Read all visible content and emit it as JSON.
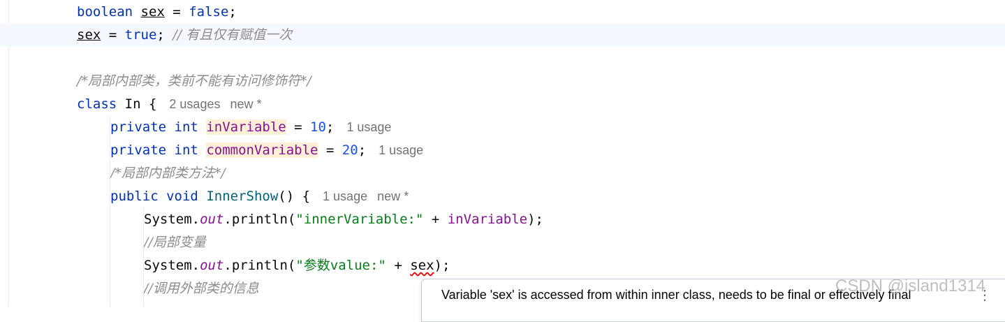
{
  "editor": {
    "lines": [
      {
        "tokens": [
          {
            "t": "boolean",
            "c": "kw"
          },
          {
            "t": " "
          },
          {
            "t": "sex",
            "c": "uline"
          },
          {
            "t": " = "
          },
          {
            "t": "false",
            "c": "bool"
          },
          {
            "t": ";"
          }
        ]
      },
      {
        "tokens": [
          {
            "t": "sex",
            "c": "uline"
          },
          {
            "t": " = "
          },
          {
            "t": "true",
            "c": "bool"
          },
          {
            "t": "; "
          },
          {
            "t": "// 有且仅有赋值一次",
            "c": "comment"
          }
        ]
      },
      {
        "tokens": []
      },
      {
        "tokens": [
          {
            "t": "/*局部内部类，类前不能有访问修饰符*/",
            "c": "comment"
          }
        ]
      },
      {
        "tokens": [
          {
            "t": "class",
            "c": "kw"
          },
          {
            "t": " In {"
          }
        ],
        "hints": [
          "2 usages",
          "new *"
        ]
      },
      {
        "tokens": [
          {
            "t": "private",
            "c": "kw"
          },
          {
            "t": " "
          },
          {
            "t": "int",
            "c": "kw"
          },
          {
            "t": " "
          },
          {
            "t": "inVariable",
            "c": "field hl"
          },
          {
            "t": " = "
          },
          {
            "t": "10",
            "c": "num"
          },
          {
            "t": ";"
          }
        ],
        "hints": [
          "1 usage"
        ]
      },
      {
        "tokens": [
          {
            "t": "private",
            "c": "kw"
          },
          {
            "t": " "
          },
          {
            "t": "int",
            "c": "kw"
          },
          {
            "t": " "
          },
          {
            "t": "commonVariable",
            "c": "field hl"
          },
          {
            "t": " = "
          },
          {
            "t": "20",
            "c": "num"
          },
          {
            "t": ";"
          }
        ],
        "hints": [
          "1 usage"
        ]
      },
      {
        "tokens": [
          {
            "t": "/*局部内部类方法*/",
            "c": "comment"
          }
        ]
      },
      {
        "tokens": [
          {
            "t": "public",
            "c": "kw"
          },
          {
            "t": " "
          },
          {
            "t": "void",
            "c": "kw"
          },
          {
            "t": " "
          },
          {
            "t": "InnerShow",
            "c": "method"
          },
          {
            "t": "() {"
          }
        ],
        "hints": [
          "1 usage",
          "new *"
        ]
      },
      {
        "tokens": [
          {
            "t": "System."
          },
          {
            "t": "out",
            "c": "static"
          },
          {
            "t": ".println("
          },
          {
            "t": "\"innerVariable:\"",
            "c": "str"
          },
          {
            "t": " + "
          },
          {
            "t": "inVariable",
            "c": "field"
          },
          {
            "t": ");"
          }
        ]
      },
      {
        "tokens": [
          {
            "t": "//局部变量",
            "c": "comment"
          }
        ]
      },
      {
        "tokens": [
          {
            "t": "System."
          },
          {
            "t": "out",
            "c": "static"
          },
          {
            "t": ".println("
          },
          {
            "t": "\"参数value:\"",
            "c": "str"
          },
          {
            "t": " + "
          },
          {
            "t": "sex",
            "c": "squiggle"
          },
          {
            "t": ");"
          }
        ]
      },
      {
        "tokens": [
          {
            "t": "//调用外部类的信息",
            "c": "comment"
          }
        ]
      }
    ]
  },
  "tooltip": {
    "message": "Variable 'sex' is accessed from within inner class, needs to be final or effectively final",
    "more_icon": "more-vertical-icon"
  },
  "gutter": {
    "bulb_icon": "lightbulb-icon"
  },
  "watermark": "CSDN @island1314",
  "colors": {
    "keyword": "#0033b3",
    "number": "#1750eb",
    "string": "#067d17",
    "field": "#871094",
    "comment": "#8c8c8c",
    "current_line": "#f5f8fe",
    "field_highlight": "#fdf0d6",
    "error": "#f50000"
  }
}
